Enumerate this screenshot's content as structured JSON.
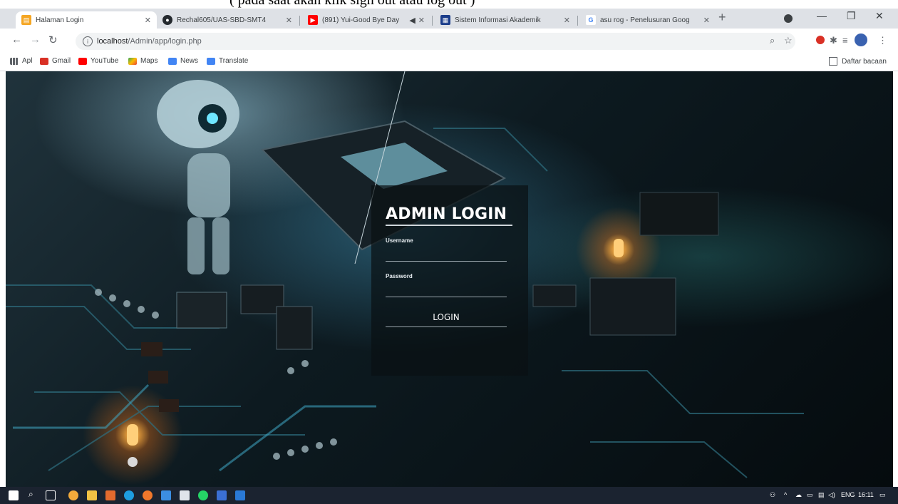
{
  "caption": "( pada saat akan klik sign out atau log out )",
  "browser": {
    "tabs": [
      {
        "label": "Halaman Login",
        "icon": "page-favicon-icon",
        "color": "#f5a623",
        "active": true
      },
      {
        "label": "Rechal605/UAS-SBD-SMT4",
        "icon": "github-icon",
        "color": "#24292e",
        "active": false
      },
      {
        "label": "(891) Yui-Good Bye Day",
        "icon": "youtube-icon",
        "color": "#ff0000",
        "active": false
      },
      {
        "label": "Sistem Informasi Akademik",
        "icon": "campus-favicon-icon",
        "color": "#1a3c8a",
        "active": false
      },
      {
        "label": "asu rog - Penelusuran Goog",
        "icon": "google-icon",
        "color": "#4285f4",
        "active": false
      }
    ],
    "address": {
      "host": "localhost",
      "path": "/Admin/app/login.php"
    },
    "bookmarks": [
      {
        "label": "Apl",
        "icon": "apps-grid-icon",
        "color": "#5f6368"
      },
      {
        "label": "Gmail",
        "icon": "gmail-icon",
        "color": "#d93025"
      },
      {
        "label": "YouTube",
        "icon": "youtube-icon",
        "color": "#ff0000"
      },
      {
        "label": "Maps",
        "icon": "maps-icon",
        "color": "#34a853"
      },
      {
        "label": "News",
        "icon": "news-icon",
        "color": "#4285f4"
      },
      {
        "label": "Translate",
        "icon": "translate-icon",
        "color": "#4285f4"
      }
    ],
    "reading_list": "Daftar bacaan"
  },
  "login": {
    "title": "ADMIN LOGIN",
    "username_label": "Username",
    "password_label": "Password",
    "username_value": "",
    "password_value": "",
    "button": "LOGIN"
  },
  "taskbar": {
    "language": "ENG",
    "time": "16:11"
  },
  "colors": {
    "tabstrip": "#dee1e6",
    "taskbar": "#1b2330",
    "login_panel": "#0a1014"
  }
}
